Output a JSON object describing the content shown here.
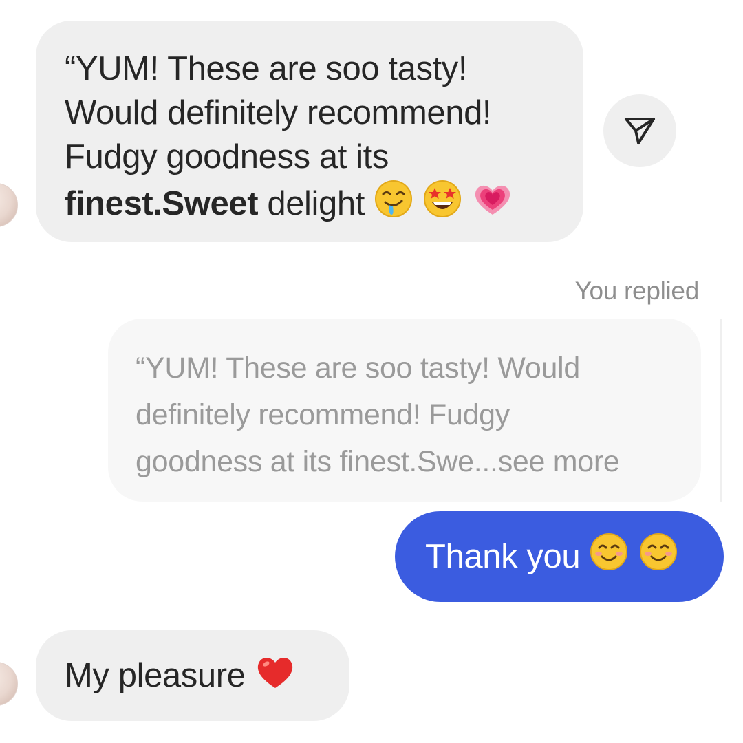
{
  "messages": {
    "received_1": {
      "line1": "“YUM! These are soo tasty!",
      "line2": "Would definitely recommend!",
      "line3": "Fudgy goodness at its",
      "line4_bold": "finest.Sweet",
      "line4_rest": " delight",
      "emojis": [
        "drooling-face",
        "star-struck",
        "growing-heart"
      ]
    },
    "reply_label": "You replied",
    "quoted": {
      "line1": "“YUM! These are soo tasty! Would",
      "line2": "definitely recommend! Fudgy",
      "line3": "goodness at its finest.Swe...see more"
    },
    "sent": {
      "text": "Thank you ",
      "emojis": [
        "smiling-face-with-smiling-eyes",
        "smiling-face-with-smiling-eyes"
      ]
    },
    "received_2": {
      "text": "My pleasure ",
      "emojis": [
        "red-heart"
      ]
    }
  },
  "icons": {
    "share": "send-paper-plane-icon"
  },
  "colors": {
    "sent_bubble": "#3b5ce0",
    "received_bubble": "#efefef",
    "quoted_text": "#9a9a9a",
    "meta_text": "#8e8e8e"
  }
}
